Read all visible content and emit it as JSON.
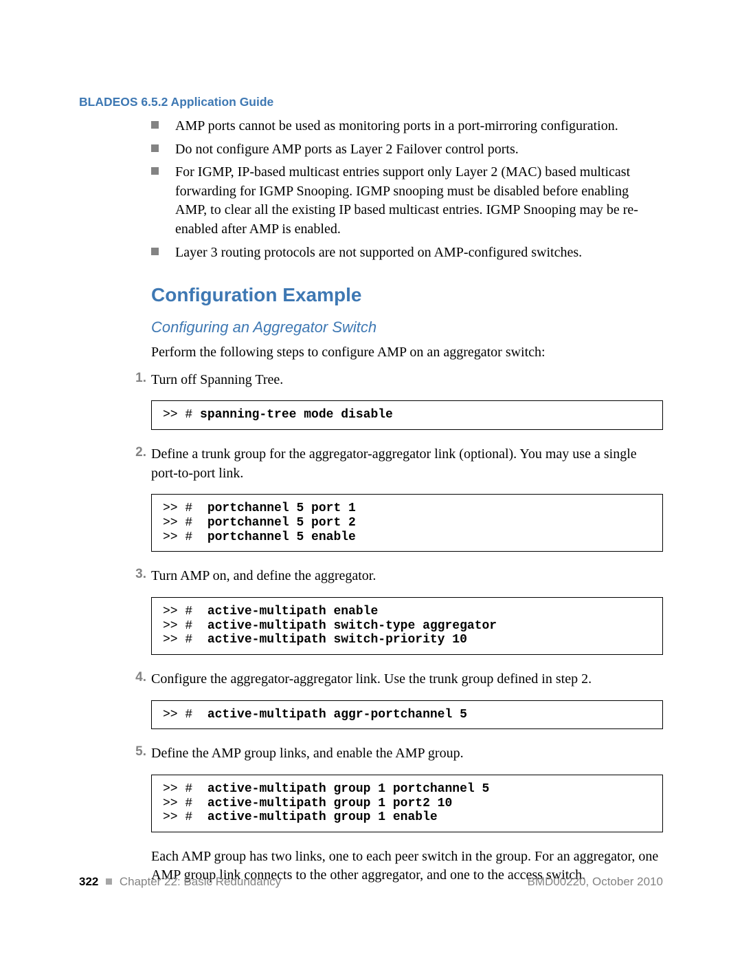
{
  "header": "BLADEOS 6.5.2 Application Guide",
  "bullets": [
    "AMP ports cannot be used as monitoring ports in a port-mirroring configuration.",
    "Do not configure AMP ports as Layer 2 Failover control ports.",
    "For IGMP, IP-based multicast entries support only Layer 2 (MAC) based multicast forwarding for IGMP Snooping. IGMP snooping must be disabled before enabling AMP, to clear all the existing IP based multicast entries. IGMP Snooping may be re-enabled after AMP is enabled.",
    "Layer 3 routing protocols are not supported on AMP-configured switches."
  ],
  "section_title": "Configuration Example",
  "subsection_title": "Configuring an Aggregator Switch",
  "intro": "Perform the following steps to configure AMP on an aggregator switch:",
  "steps": {
    "s1": {
      "num": "1.",
      "text": "Turn off Spanning Tree."
    },
    "s2": {
      "num": "2.",
      "text": "Define a trunk group for the aggregator-aggregator link (optional). You may use a single port-to-port link."
    },
    "s3": {
      "num": "3.",
      "text": "Turn AMP on, and define the aggregator."
    },
    "s4": {
      "num": "4.",
      "text": "Configure the aggregator-aggregator link. Use the trunk group defined in step 2."
    },
    "s5": {
      "num": "5.",
      "text": "Define the AMP group links, and enable the AMP group."
    }
  },
  "code": {
    "p1": ">> # ",
    "c1": {
      "l1": "spanning-tree mode disable"
    },
    "c2": {
      "l1": "portchannel 5 port 1",
      "l2": "portchannel 5 port 2",
      "l3": "portchannel 5 enable"
    },
    "c3": {
      "l1": "active-multipath enable",
      "l2": "active-multipath switch-type aggregator",
      "l3": "active-multipath switch-priority 10"
    },
    "c4": {
      "l1": "active-multipath aggr-portchannel 5"
    },
    "c5": {
      "l1": "active-multipath group 1 portchannel 5",
      "l2": "active-multipath group 1 port2 10",
      "l3": "active-multipath group 1 enable"
    }
  },
  "closing": "Each AMP group has two links, one to each peer switch in the group. For an aggregator, one AMP group link connects to the other aggregator, and one to the access switch.",
  "footer": {
    "page": "322",
    "chapter": "Chapter 22: Basic Redundancy",
    "docid": "BMD00220, October 2010"
  }
}
